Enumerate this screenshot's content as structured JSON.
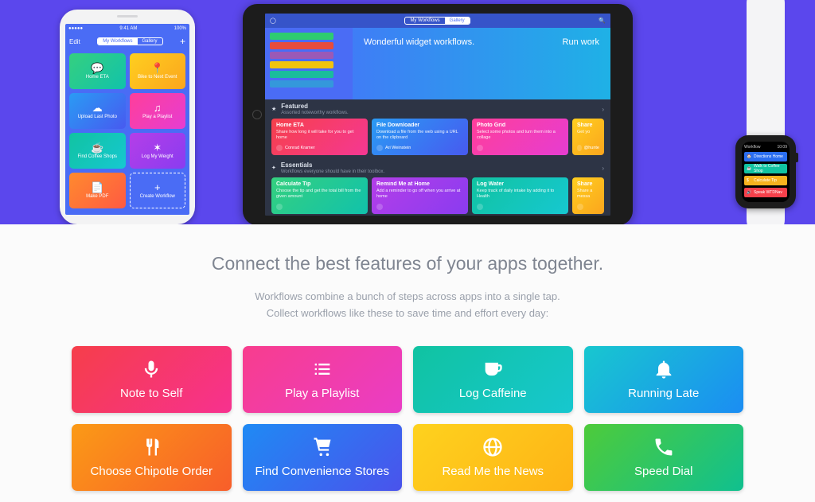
{
  "iphone": {
    "status": {
      "carrier": "●●●●●",
      "time": "9:41 AM",
      "battery": "100%"
    },
    "nav": {
      "edit": "Edit",
      "tabs": [
        "My Workflows",
        "Gallery"
      ],
      "active": 0,
      "add": "+"
    },
    "tiles": [
      {
        "icon": "💬",
        "label": "Home ETA",
        "grad": "pg-green"
      },
      {
        "icon": "📍",
        "label": "Bike to Next Event",
        "grad": "pg-yellow"
      },
      {
        "icon": "☁",
        "label": "Upload Last Photo",
        "grad": "pg-blue"
      },
      {
        "icon": "♫",
        "label": "Play a Playlist",
        "grad": "pg-pink"
      },
      {
        "icon": "☕",
        "label": "Find Coffee Shops",
        "grad": "pg-teal"
      },
      {
        "icon": "✶",
        "label": "Log My Weight",
        "grad": "pg-purple"
      },
      {
        "icon": "📄",
        "label": "Make PDF",
        "grad": "pg-orange"
      }
    ],
    "create": "Create Workflow"
  },
  "ipad": {
    "nav": {
      "user": "◯",
      "tabs": [
        "My Workflows",
        "Gallery"
      ],
      "active": 1,
      "search": "🔍"
    },
    "banner": {
      "title": "Wonderful widget workflows.",
      "cta": "Run work"
    },
    "sections": [
      {
        "icon": "★",
        "title": "Featured",
        "subtitle": "Assorted noteworthy workflows.",
        "cards": [
          {
            "title": "Home ETA",
            "desc": "Share how long it will take for you to get home",
            "author": "Conrad Kramer",
            "grad": "cg-red"
          },
          {
            "title": "File Downloader",
            "desc": "Download a file from the web using a URL on the clipboard",
            "author": "Ari Weinstein",
            "grad": "cg-blue"
          },
          {
            "title": "Photo Grid",
            "desc": "Select some photos and turn them into a collage",
            "author": "",
            "grad": "cg-pink"
          },
          {
            "title": "Share",
            "desc": "Get yo",
            "author": "@hunte",
            "grad": "cg-yellow"
          }
        ]
      },
      {
        "icon": "✦",
        "title": "Essentials",
        "subtitle": "Workflows everyone should have in their toolbox.",
        "cards": [
          {
            "title": "Calculate Tip",
            "desc": "Choose the tip and get the total bill from the given amount",
            "author": "",
            "grad": "cg-green"
          },
          {
            "title": "Remind Me at Home",
            "desc": "Add a reminder to go off when you arrive at home",
            "author": "",
            "grad": "cg-purple"
          },
          {
            "title": "Log Water",
            "desc": "Keep track of daily intake by adding it to Health",
            "author": "",
            "grad": "cg-teal"
          },
          {
            "title": "Share",
            "desc": "Share a messa",
            "author": "",
            "grad": "cg-yellow"
          }
        ]
      }
    ],
    "mini_rows": [
      "#2ecc71",
      "#e74c3c",
      "#9b59b6",
      "#f1c40f",
      "#1abc9c",
      "#3498db"
    ]
  },
  "watch": {
    "title": "Workflow",
    "time": "10:09",
    "rows": [
      {
        "label": "Directions Home",
        "cls": "wr-blue",
        "icon": "🏠"
      },
      {
        "label": "Walk to Coffee Shop",
        "cls": "wr-teal",
        "icon": "☕"
      },
      {
        "label": "Calculate Tip",
        "cls": "wr-yellow",
        "icon": "$"
      },
      {
        "label": "Speak WTDNav",
        "cls": "wr-red",
        "icon": "🔊"
      }
    ]
  },
  "marketing": {
    "heading": "Connect the best features of your apps together.",
    "sub1": "Workflows combine a bunch of steps across apps into a single tap.",
    "sub2": "Collect workflows like these to save time and effort every day:",
    "tiles": [
      {
        "label": "Note to Self",
        "grad": "g-redpink",
        "icon": "mic"
      },
      {
        "label": "Play a Playlist",
        "grad": "g-pink",
        "icon": "list"
      },
      {
        "label": "Log Caffeine",
        "grad": "g-tealcyan",
        "icon": "cup"
      },
      {
        "label": "Running Late",
        "grad": "g-cyanblue",
        "icon": "bell"
      },
      {
        "label": "Choose Chipotle Order",
        "grad": "g-orange",
        "icon": "food"
      },
      {
        "label": "Find Convenience Stores",
        "grad": "g-blue",
        "icon": "cart"
      },
      {
        "label": "Read Me the News",
        "grad": "g-yellow",
        "icon": "globe"
      },
      {
        "label": "Speed Dial",
        "grad": "g-green",
        "icon": "phone"
      }
    ]
  }
}
